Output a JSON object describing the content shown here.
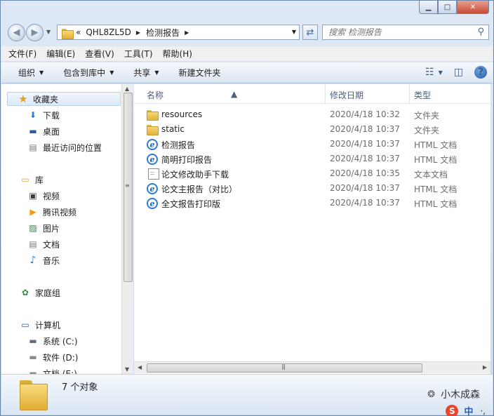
{
  "window": {
    "min_label": "▁",
    "max_label": "□",
    "close_label": "✕"
  },
  "address": {
    "overflow": "«",
    "crumbs": [
      "QHL8ZL5D",
      "检测报告"
    ],
    "search_placeholder": "搜索 检测报告"
  },
  "menubar": [
    "文件(F)",
    "编辑(E)",
    "查看(V)",
    "工具(T)",
    "帮助(H)"
  ],
  "commands": [
    "组织",
    "包含到库中",
    "共享",
    "新建文件夹"
  ],
  "nav": {
    "favorites": "收藏夹",
    "fav_items": [
      "下载",
      "桌面",
      "最近访问的位置"
    ],
    "libraries": "库",
    "lib_items": [
      "视频",
      "腾讯视频",
      "图片",
      "文档",
      "音乐"
    ],
    "homegroup": "家庭组",
    "computer": "计算机",
    "drives": [
      "系统 (C:)",
      "软件 (D:)",
      "文档 (E:)"
    ]
  },
  "columns": {
    "name": "名称",
    "date": "修改日期",
    "type": "类型"
  },
  "files": [
    {
      "name": "resources",
      "date": "2020/4/18 10:32",
      "type": "文件夹",
      "icon": "folder-icon"
    },
    {
      "name": "static",
      "date": "2020/4/18 10:37",
      "type": "文件夹",
      "icon": "folder-icon"
    },
    {
      "name": "检测报告",
      "date": "2020/4/18 10:37",
      "type": "HTML 文档",
      "icon": "ie-html-icon"
    },
    {
      "name": "简明打印报告",
      "date": "2020/4/18 10:37",
      "type": "HTML 文档",
      "icon": "ie-html-icon"
    },
    {
      "name": "论文修改助手下载",
      "date": "2020/4/18 10:35",
      "type": "文本文档",
      "icon": "text-document-icon"
    },
    {
      "name": "论文主报告（对比）",
      "date": "2020/4/18 10:37",
      "type": "HTML 文档",
      "icon": "ie-html-icon"
    },
    {
      "name": "全文报告打印版",
      "date": "2020/4/18 10:37",
      "type": "HTML 文档",
      "icon": "ie-html-icon"
    }
  ],
  "details": {
    "count": "7 个对象"
  },
  "watermark": "小木成森",
  "ime": {
    "logo": "S",
    "lang": "中",
    "punct": "·,"
  }
}
